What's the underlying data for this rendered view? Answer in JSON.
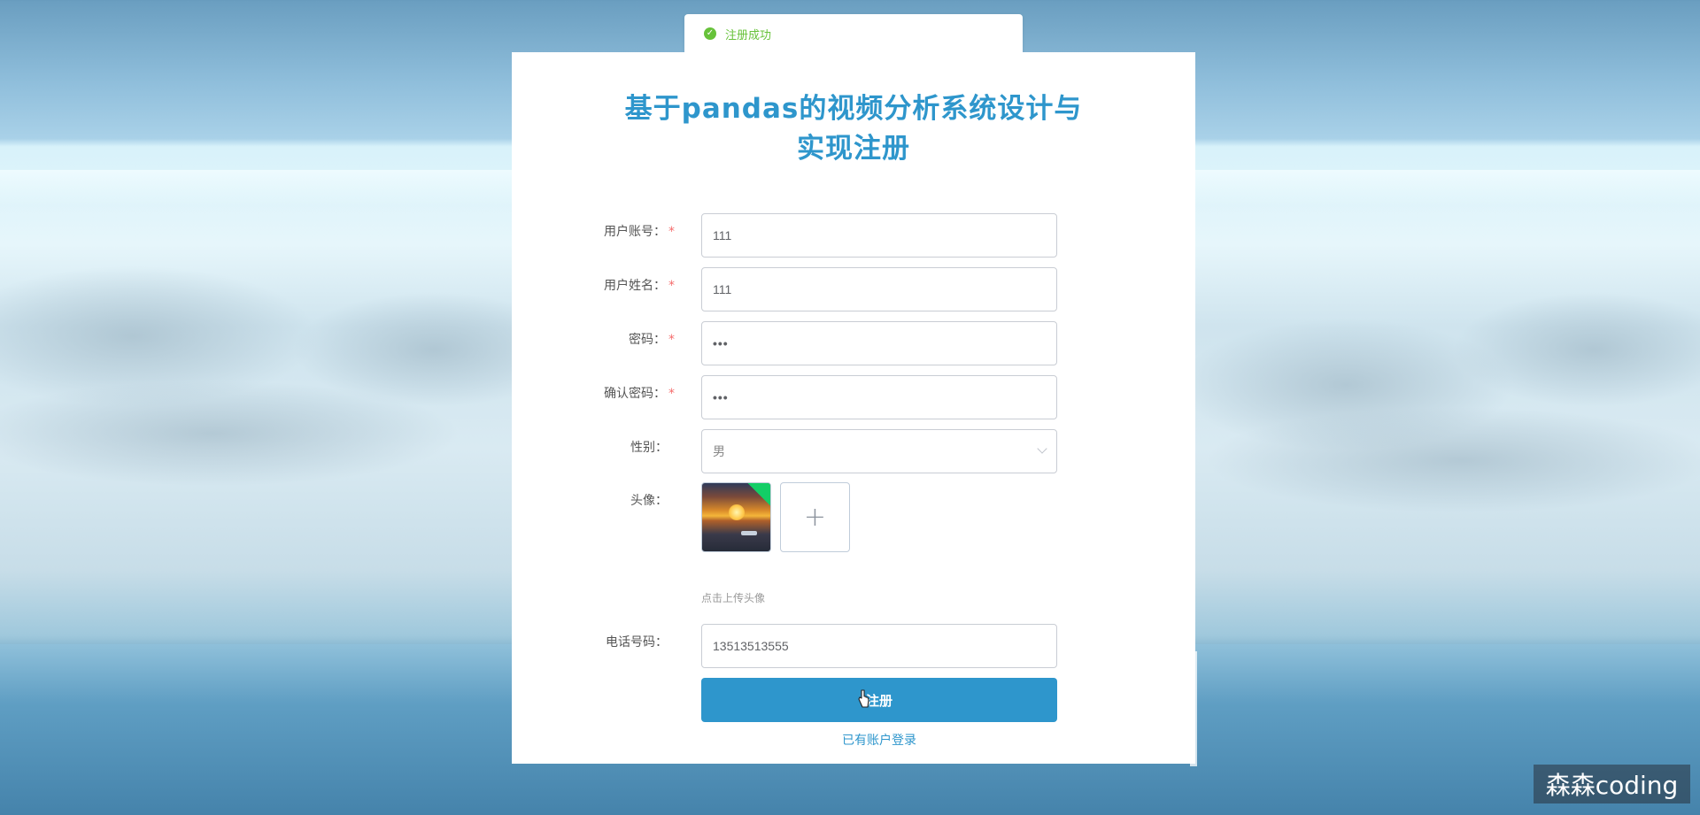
{
  "toast": {
    "message": "注册成功",
    "icon": "check-circle-icon"
  },
  "form": {
    "title": "基于pandas的视频分析系统设计与实现注册",
    "account": {
      "label": "用户账号：",
      "value": "111"
    },
    "name": {
      "label": "用户姓名：",
      "value": "111"
    },
    "password": {
      "label": "密码：",
      "value": "•••"
    },
    "confirm_password": {
      "label": "确认密码：",
      "value": "•••"
    },
    "gender": {
      "label": "性别：",
      "value": "男"
    },
    "avatar": {
      "label": "头像：",
      "hint": "点击上传头像",
      "add_symbol": "+"
    },
    "phone": {
      "label": "电话号码：",
      "value": "13513513555"
    },
    "required_mark": "*",
    "submit_label": "注册",
    "login_link": "已有账户登录"
  },
  "watermark": "森森coding",
  "colors": {
    "primary": "#2e96cc",
    "success": "#67c23a",
    "required": "#f56c6c"
  }
}
